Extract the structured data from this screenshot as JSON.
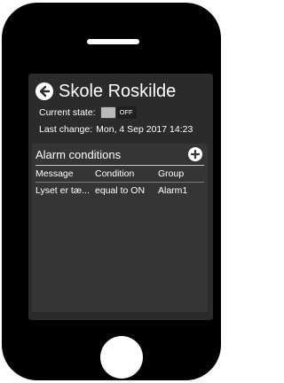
{
  "header": {
    "title": "Skole Roskilde",
    "back_icon": "arrow-left-icon"
  },
  "state": {
    "label": "Current state:",
    "toggle_text": "OFF",
    "toggle_on": false
  },
  "last_change": {
    "label": "Last change:",
    "value": "Mon, 4 Sep 2017 14:23"
  },
  "alarms": {
    "title": "Alarm conditions",
    "add_icon": "plus-icon",
    "columns": [
      "Message",
      "Condition",
      "Group"
    ],
    "rows": [
      {
        "message": "Lyset er tæ...",
        "condition": "equal to ON",
        "group": "Alarm1"
      }
    ]
  },
  "colors": {
    "screen_bg": "#2b2b2b",
    "panel_bg": "#353535",
    "text": "#ffffff",
    "device": "#000000"
  }
}
